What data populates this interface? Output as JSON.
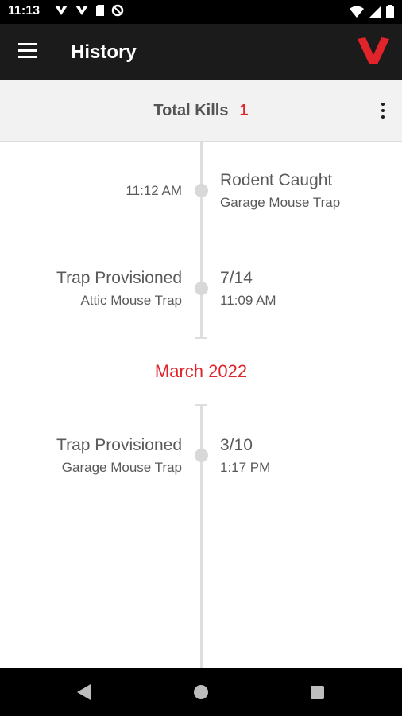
{
  "status_bar": {
    "time": "11:13",
    "left_icons": [
      "vexi-notification-icon",
      "vexi-notification-icon",
      "sd-card-icon",
      "data-saver-icon"
    ],
    "right_icons": [
      "wifi-icon",
      "cell-signal-icon",
      "battery-icon"
    ]
  },
  "app_bar": {
    "title": "History",
    "brand_color": "#e0242a"
  },
  "summary": {
    "total_label": "Total Kills",
    "total_count": "1"
  },
  "timeline": {
    "events": [
      {
        "left_main": "",
        "left_sub": "11:12 AM",
        "right_main": "Rodent Caught",
        "right_sub": "Garage Mouse Trap"
      },
      {
        "left_main": "Trap Provisioned",
        "left_sub": "Attic Mouse Trap",
        "right_main": "7/14",
        "right_sub": "11:09 AM"
      },
      {
        "left_main": "Trap Provisioned",
        "left_sub": "Garage Mouse Trap",
        "right_main": "3/10",
        "right_sub": "1:17 PM"
      }
    ],
    "month_header": "March 2022",
    "accent_color": "#e0242a"
  },
  "nav_bar": {
    "buttons": [
      "back-icon",
      "home-icon",
      "recents-icon"
    ]
  }
}
